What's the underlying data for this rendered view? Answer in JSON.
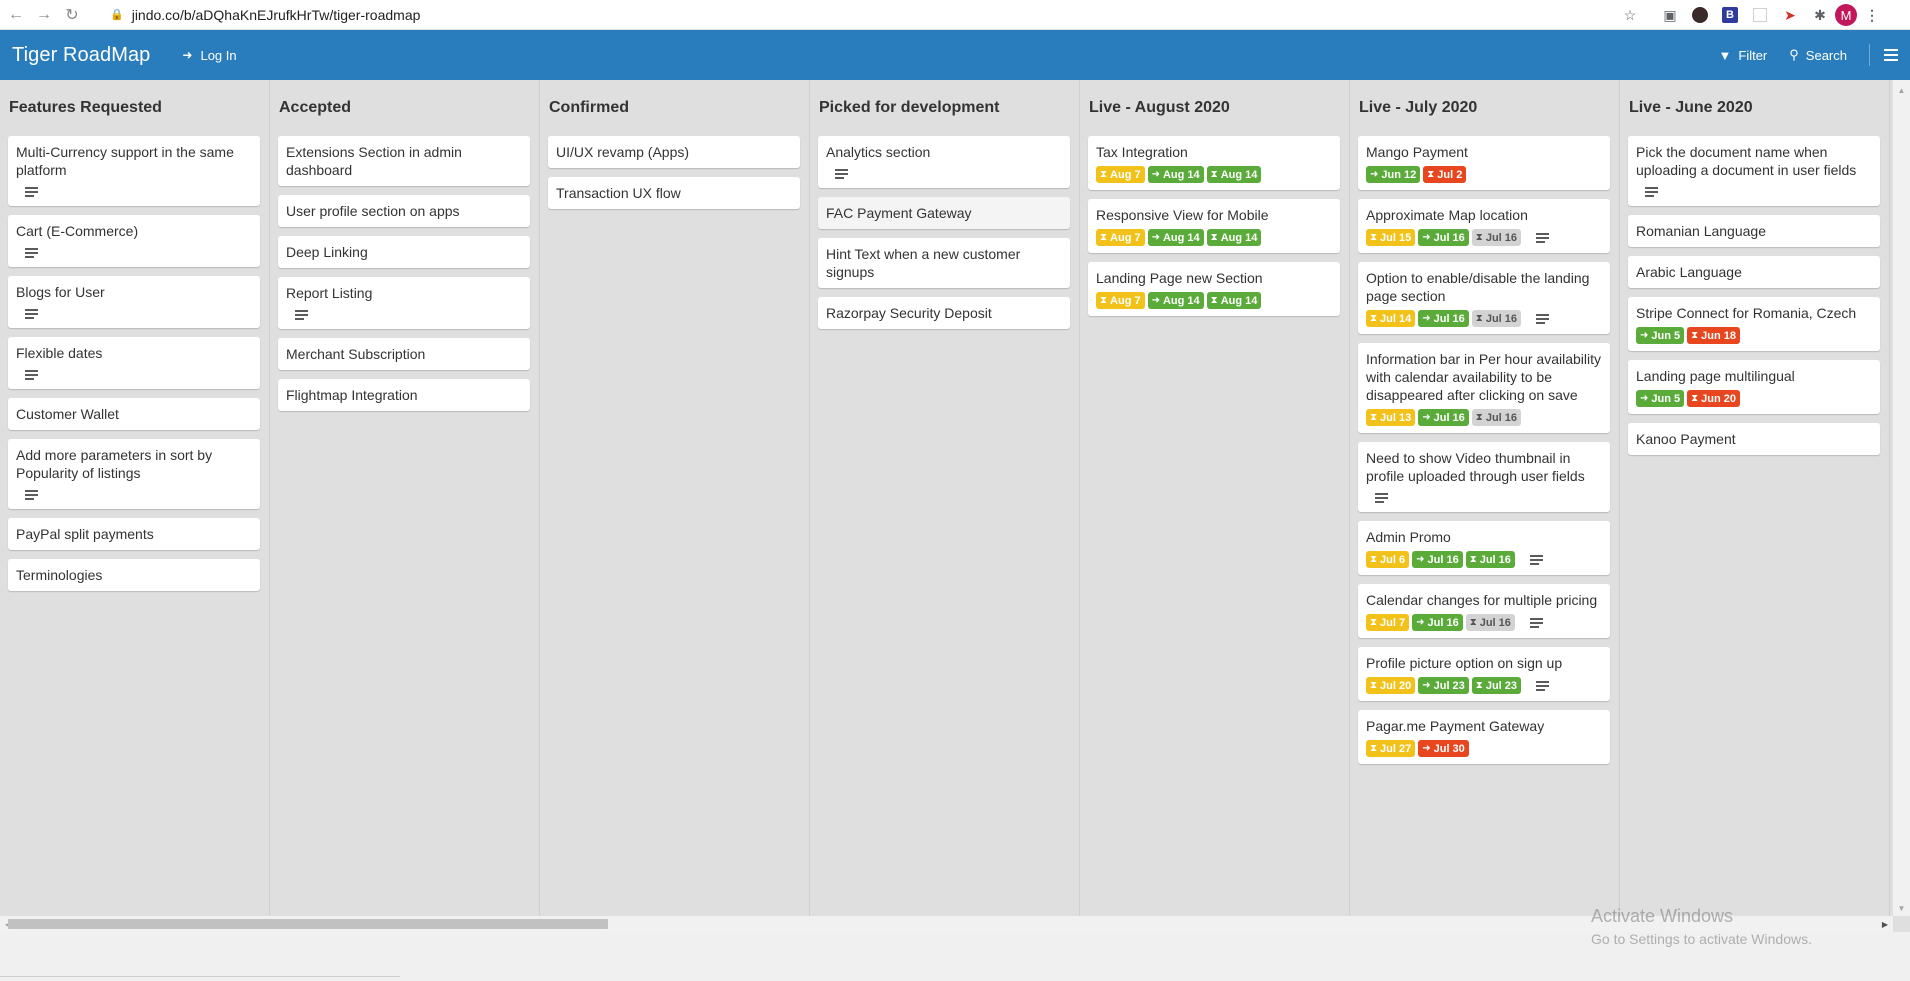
{
  "browser": {
    "url": "jindo.co/b/aDQhaKnEJrufkHrTw/tiger-roadmap",
    "profile_initial": "M",
    "icons": [
      "back-icon",
      "forward-icon",
      "reload-icon",
      "lock-icon",
      "star-icon",
      "camera-icon",
      "extensions-icon"
    ]
  },
  "header": {
    "title": "Tiger RoadMap",
    "login_label": "Log In",
    "filter_label": "Filter",
    "search_label": "Search"
  },
  "colors": {
    "header": "#2a7dbd",
    "board_bg": "#dfdfdf",
    "badge_yellow": "#f2c21b",
    "badge_green": "#5aab3a",
    "badge_red": "#e8461f",
    "badge_gray": "#d3d3d3"
  },
  "columns": [
    {
      "title": "Features Requested",
      "cards": [
        {
          "title": "Multi-Currency support in the same platform",
          "desc": true,
          "badges": []
        },
        {
          "title": "Cart (E-Commerce)",
          "desc": true,
          "badges": []
        },
        {
          "title": "Blogs for User",
          "desc": true,
          "badges": []
        },
        {
          "title": "Flexible dates",
          "desc": true,
          "badges": []
        },
        {
          "title": "Customer Wallet",
          "desc": false,
          "badges": []
        },
        {
          "title": "Add more parameters in sort by Popularity of listings",
          "desc": true,
          "badges": []
        },
        {
          "title": "PayPal split payments",
          "desc": false,
          "badges": []
        },
        {
          "title": "Terminologies",
          "desc": false,
          "badges": []
        }
      ]
    },
    {
      "title": "Accepted",
      "cards": [
        {
          "title": "Extensions Section in admin dashboard",
          "desc": false,
          "badges": []
        },
        {
          "title": "User profile section on apps",
          "desc": false,
          "badges": []
        },
        {
          "title": "Deep Linking",
          "desc": false,
          "badges": []
        },
        {
          "title": "Report Listing",
          "desc": true,
          "badges": []
        },
        {
          "title": "Merchant Subscription",
          "desc": false,
          "badges": []
        },
        {
          "title": "Flightmap Integration",
          "desc": false,
          "badges": []
        }
      ]
    },
    {
      "title": "Confirmed",
      "cards": [
        {
          "title": "UI/UX revamp (Apps)",
          "desc": false,
          "badges": []
        },
        {
          "title": "Transaction UX flow",
          "desc": false,
          "badges": []
        }
      ]
    },
    {
      "title": "Picked for development",
      "cards": [
        {
          "title": "Analytics section",
          "desc": true,
          "badges": []
        },
        {
          "title": "FAC Payment Gateway",
          "desc": false,
          "badges": [],
          "highlight": true
        },
        {
          "title": "Hint Text when a new customer signups",
          "desc": false,
          "badges": []
        },
        {
          "title": "Razorpay Security Deposit",
          "desc": false,
          "badges": []
        }
      ]
    },
    {
      "title": "Live - August 2020",
      "cards": [
        {
          "title": "Tax Integration",
          "desc": false,
          "badges": [
            {
              "color": "yellow",
              "icon": "hourglass-icon",
              "label": "Aug 7"
            },
            {
              "color": "green",
              "icon": "sign-in-icon",
              "label": "Aug 14"
            },
            {
              "color": "green",
              "icon": "hourglass-icon",
              "label": "Aug 14"
            }
          ]
        },
        {
          "title": "Responsive View for Mobile",
          "desc": false,
          "badges": [
            {
              "color": "yellow",
              "icon": "hourglass-icon",
              "label": "Aug 7"
            },
            {
              "color": "green",
              "icon": "sign-in-icon",
              "label": "Aug 14"
            },
            {
              "color": "green",
              "icon": "hourglass-icon",
              "label": "Aug 14"
            }
          ]
        },
        {
          "title": "Landing Page new Section",
          "desc": false,
          "badges": [
            {
              "color": "yellow",
              "icon": "hourglass-icon",
              "label": "Aug 7"
            },
            {
              "color": "green",
              "icon": "sign-in-icon",
              "label": "Aug 14"
            },
            {
              "color": "green",
              "icon": "hourglass-icon",
              "label": "Aug 14"
            }
          ]
        }
      ]
    },
    {
      "title": "Live - July 2020",
      "cards": [
        {
          "title": "Mango Payment",
          "desc": false,
          "badges": [
            {
              "color": "green",
              "icon": "sign-in-icon",
              "label": "Jun 12"
            },
            {
              "color": "red",
              "icon": "hourglass-icon",
              "label": "Jul 2"
            }
          ]
        },
        {
          "title": "Approximate Map location",
          "desc": true,
          "badges": [
            {
              "color": "yellow",
              "icon": "hourglass-icon",
              "label": "Jul 15"
            },
            {
              "color": "green",
              "icon": "sign-in-icon",
              "label": "Jul 16"
            },
            {
              "color": "gray",
              "icon": "hourglass-icon",
              "label": "Jul 16"
            }
          ]
        },
        {
          "title": "Option to enable/disable the landing page section",
          "desc": true,
          "badges": [
            {
              "color": "yellow",
              "icon": "hourglass-icon",
              "label": "Jul 14"
            },
            {
              "color": "green",
              "icon": "sign-in-icon",
              "label": "Jul 16"
            },
            {
              "color": "gray",
              "icon": "hourglass-icon",
              "label": "Jul 16"
            }
          ]
        },
        {
          "title": "Information bar in Per hour availability with calendar availability to be disappeared after clicking on save",
          "desc": false,
          "badges": [
            {
              "color": "yellow",
              "icon": "hourglass-icon",
              "label": "Jul 13"
            },
            {
              "color": "green",
              "icon": "sign-in-icon",
              "label": "Jul 16"
            },
            {
              "color": "gray",
              "icon": "hourglass-icon",
              "label": "Jul 16"
            }
          ]
        },
        {
          "title": "Need to show Video thumbnail in profile uploaded through user fields",
          "desc": true,
          "badges": []
        },
        {
          "title": "Admin Promo",
          "desc": true,
          "badges": [
            {
              "color": "yellow",
              "icon": "hourglass-icon",
              "label": "Jul 6"
            },
            {
              "color": "green",
              "icon": "sign-in-icon",
              "label": "Jul 16"
            },
            {
              "color": "green",
              "icon": "hourglass-icon",
              "label": "Jul 16"
            }
          ]
        },
        {
          "title": "Calendar changes for multiple pricing",
          "desc": true,
          "badges": [
            {
              "color": "yellow",
              "icon": "hourglass-icon",
              "label": "Jul 7"
            },
            {
              "color": "green",
              "icon": "sign-in-icon",
              "label": "Jul 16"
            },
            {
              "color": "gray",
              "icon": "hourglass-icon",
              "label": "Jul 16"
            }
          ]
        },
        {
          "title": "Profile picture option on sign up",
          "desc": true,
          "badges": [
            {
              "color": "yellow",
              "icon": "hourglass-icon",
              "label": "Jul 20"
            },
            {
              "color": "green",
              "icon": "sign-in-icon",
              "label": "Jul 23"
            },
            {
              "color": "green",
              "icon": "hourglass-icon",
              "label": "Jul 23"
            }
          ]
        },
        {
          "title": "Pagar.me Payment Gateway",
          "desc": false,
          "badges": [
            {
              "color": "yellow",
              "icon": "hourglass-icon",
              "label": "Jul 27"
            },
            {
              "color": "red",
              "icon": "sign-in-icon",
              "label": "Jul 30"
            }
          ]
        }
      ]
    },
    {
      "title": "Live - June 2020",
      "cards": [
        {
          "title": "Pick the document name when uploading a document in user fields",
          "desc": true,
          "badges": []
        },
        {
          "title": "Romanian Language",
          "desc": false,
          "badges": []
        },
        {
          "title": "Arabic Language",
          "desc": false,
          "badges": []
        },
        {
          "title": "Stripe Connect for Romania, Czech",
          "desc": false,
          "badges": [
            {
              "color": "green",
              "icon": "sign-in-icon",
              "label": "Jun 5"
            },
            {
              "color": "red",
              "icon": "hourglass-icon",
              "label": "Jun 18"
            }
          ]
        },
        {
          "title": "Landing page multilingual",
          "desc": false,
          "badges": [
            {
              "color": "green",
              "icon": "sign-in-icon",
              "label": "Jun 5"
            },
            {
              "color": "red",
              "icon": "hourglass-icon",
              "label": "Jun 20"
            }
          ]
        },
        {
          "title": "Kanoo Payment",
          "desc": false,
          "badges": []
        }
      ]
    }
  ],
  "watermark": {
    "line1": "Activate Windows",
    "line2": "Go to Settings to activate Windows."
  }
}
